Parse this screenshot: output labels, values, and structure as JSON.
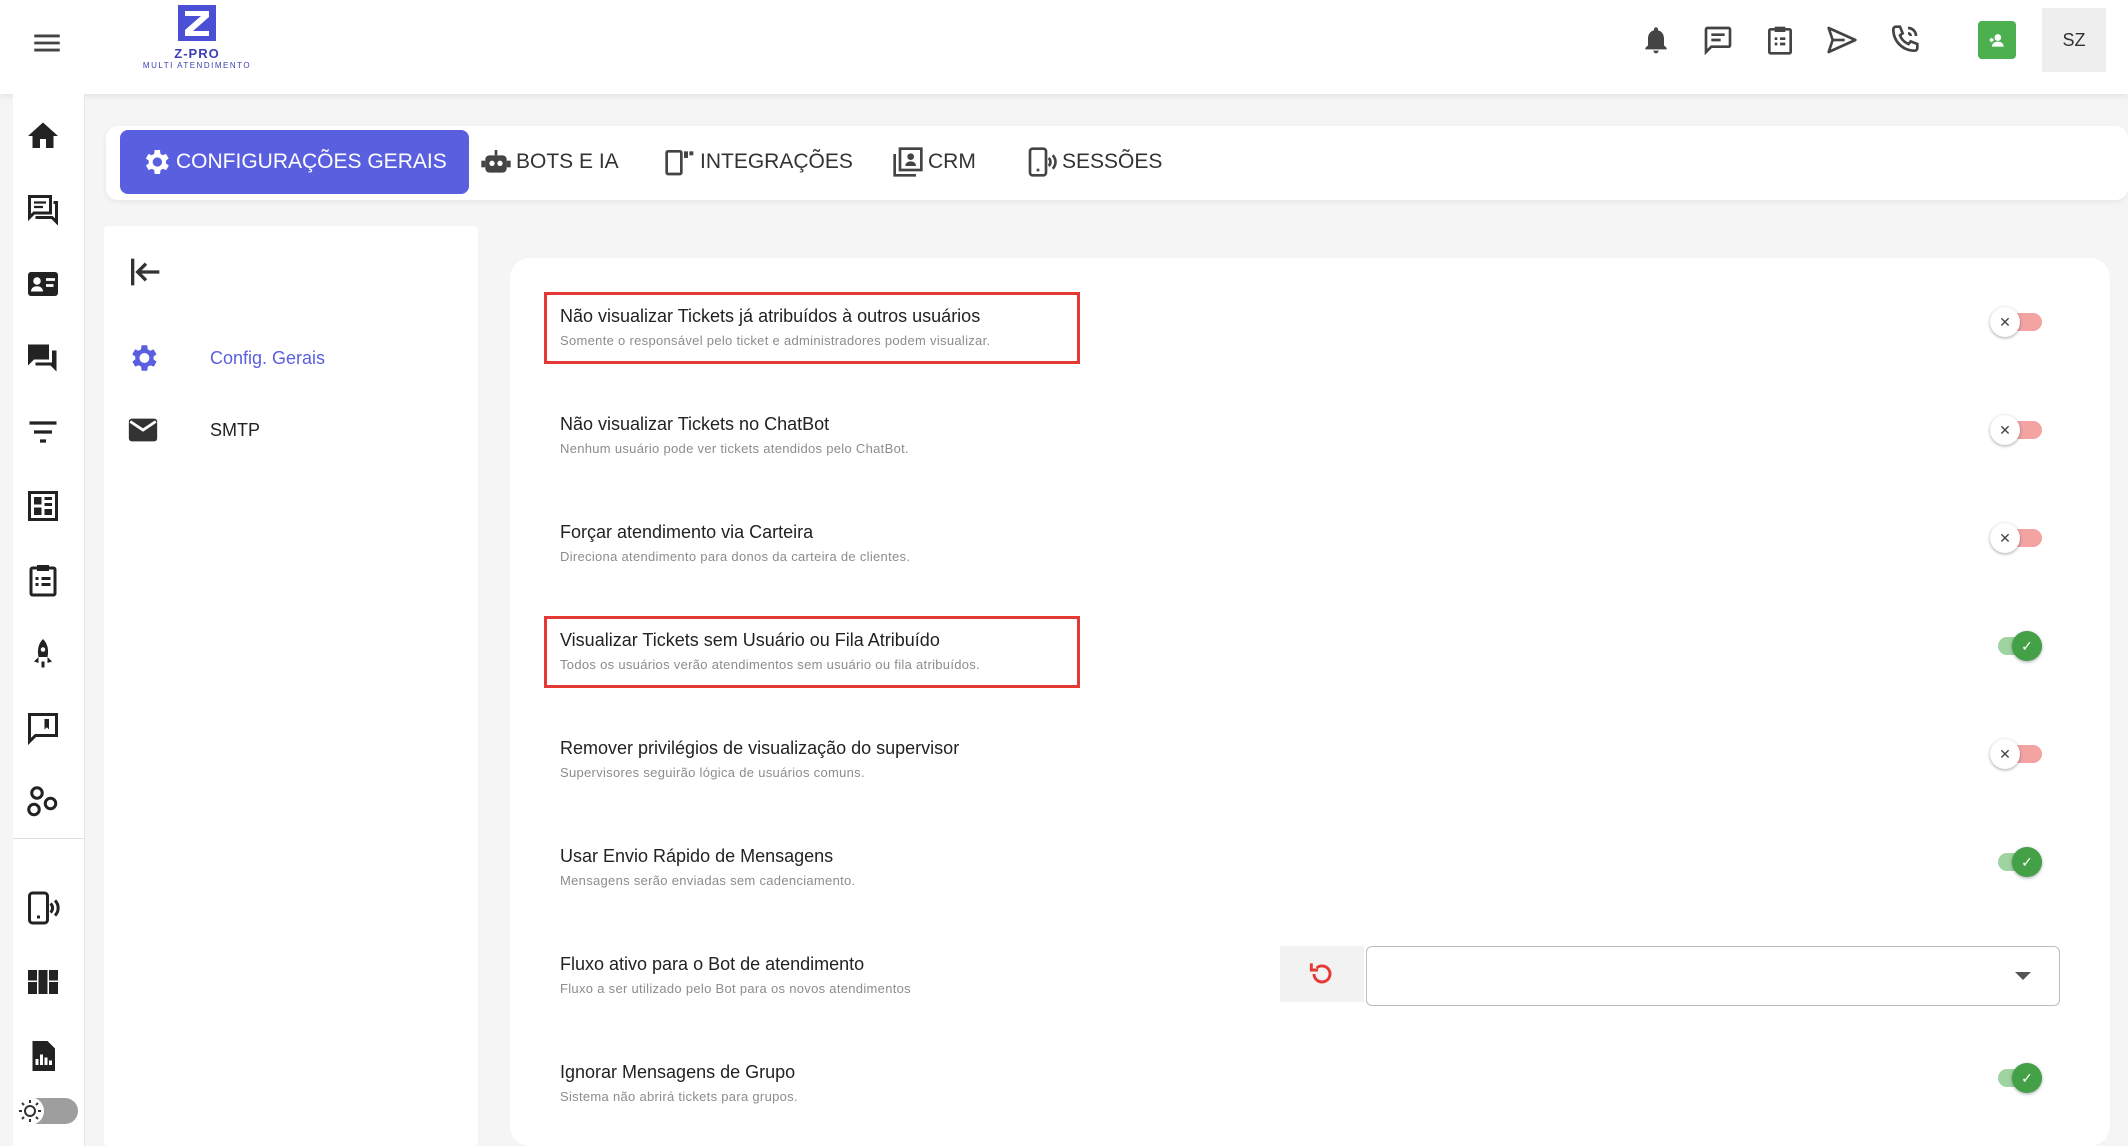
{
  "header": {
    "logo_name": "Z-PRO",
    "logo_subtitle": "MULTI ATENDIMENTO",
    "avatar_initials": "SZ",
    "icons": [
      "bell-icon",
      "chat-icon",
      "clipboard-icon",
      "send-icon",
      "phone-icon",
      "contact-icon"
    ]
  },
  "tabs": [
    {
      "label": "CONFIGURAÇÕES GERAIS",
      "icon": "gear-icon",
      "active": true
    },
    {
      "label": "BOTS E IA",
      "icon": "robot-icon",
      "active": false
    },
    {
      "label": "INTEGRAÇÕES",
      "icon": "integration-icon",
      "active": false
    },
    {
      "label": "CRM",
      "icon": "crm-icon",
      "active": false
    },
    {
      "label": "SESSÕES",
      "icon": "session-phone-icon",
      "active": false
    }
  ],
  "side_menu": {
    "items": [
      {
        "label": "Config. Gerais",
        "icon": "gear-icon",
        "active": true
      },
      {
        "label": "SMTP",
        "icon": "mail-icon",
        "active": false
      }
    ]
  },
  "settings": [
    {
      "title": "Não visualizar Tickets já atribuídos à outros usuários",
      "description": "Somente o responsável pelo ticket e administradores podem visualizar.",
      "enabled": false,
      "highlighted": true
    },
    {
      "title": "Não visualizar Tickets no ChatBot",
      "description": "Nenhum usuário pode ver tickets atendidos pelo ChatBot.",
      "enabled": false,
      "highlighted": false
    },
    {
      "title": "Forçar atendimento via Carteira",
      "description": "Direciona atendimento para donos da carteira de clientes.",
      "enabled": false,
      "highlighted": false
    },
    {
      "title": "Visualizar Tickets sem Usuário ou Fila Atribuído",
      "description": "Todos os usuários verão atendimentos sem usuário ou fila atribuídos.",
      "enabled": true,
      "highlighted": true
    },
    {
      "title": "Remover privilégios de visualização do supervisor",
      "description": "Supervisores seguirão lógica de usuários comuns.",
      "enabled": false,
      "highlighted": false
    },
    {
      "title": "Usar Envio Rápido de Mensagens",
      "description": "Mensagens serão enviadas sem cadenciamento.",
      "enabled": true,
      "highlighted": false
    },
    {
      "title": "Fluxo ativo para o Bot de atendimento",
      "description": "Fluxo a ser utilizado pelo Bot para os novos atendimentos",
      "control": "select",
      "selected_value": "",
      "highlighted": false
    },
    {
      "title": "Ignorar Mensagens de Grupo",
      "description": "Sistema não abrirá tickets para grupos.",
      "enabled": true,
      "highlighted": false
    }
  ],
  "colors": {
    "accent": "#5a5fe0",
    "highlight_border": "#e53935",
    "switch_on": "#43a047",
    "switch_off_track": "#f4a3a3",
    "contact_button": "#4caf50"
  }
}
